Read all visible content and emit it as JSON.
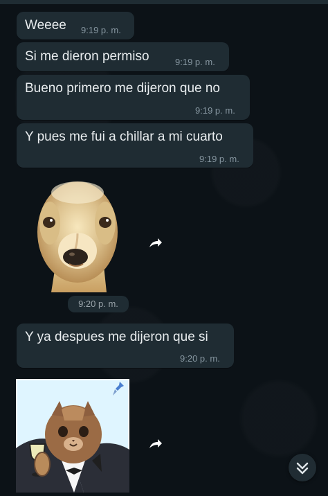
{
  "messages": [
    {
      "text": "Weeee",
      "time": "9:19 p. m."
    },
    {
      "text": "Si me dieron permiso",
      "time": "9:19 p. m."
    },
    {
      "text": "Bueno primero me dijeron que no",
      "time": "9:19 p. m."
    },
    {
      "text": "Y pues me fui a chillar a mi cuarto",
      "time": "9:19 p. m."
    },
    {
      "text": "",
      "time": "9:20 p. m."
    },
    {
      "text": "Y ya despues me dijeron que si",
      "time": "9:20 p. m."
    }
  ],
  "icons": {
    "forward": "forward-icon",
    "scroll_down": "chevron-down-icon",
    "pin": "pin-icon"
  },
  "colors": {
    "chat_background": "#0c1217",
    "bubble": "#1f2c33",
    "text": "#e9edef",
    "timestamp": "#8696a0"
  }
}
